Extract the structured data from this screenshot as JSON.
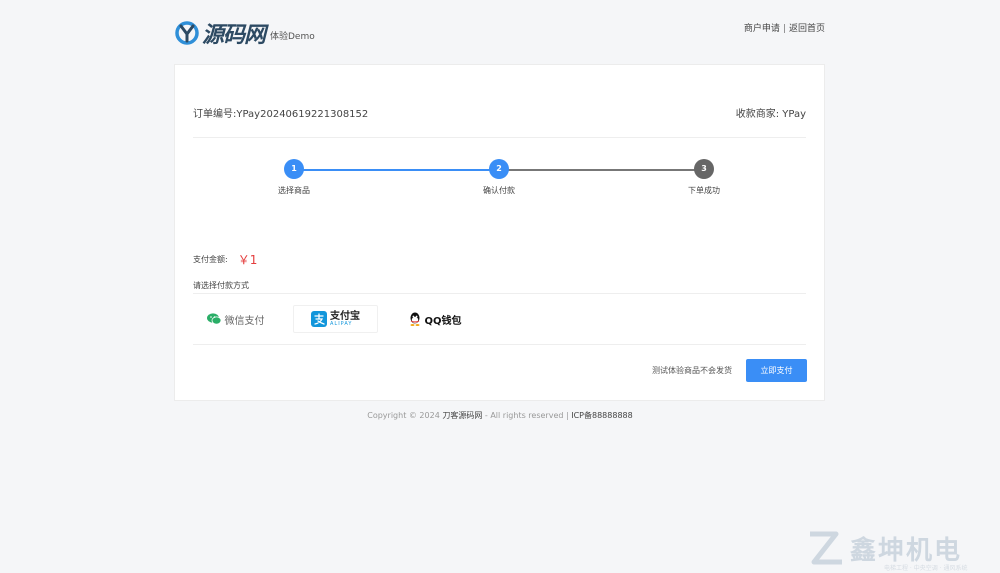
{
  "brand": {
    "logo_text": "源码网",
    "subtitle": "体验Demo",
    "accent_color": "#3a8ef6"
  },
  "top_links": {
    "merchant_apply": "商户申请",
    "separator": "|",
    "back_home": "返回首页"
  },
  "order": {
    "order_no": "订单编号:YPay20240619221308152",
    "merchant": "收款商家: YPay"
  },
  "steps": [
    {
      "num": "1",
      "label": "选择商品",
      "status": "done"
    },
    {
      "num": "2",
      "label": "确认付款",
      "status": "current"
    },
    {
      "num": "3",
      "label": "下单成功",
      "status": "pending"
    }
  ],
  "payment": {
    "amount_label": "支付金额:",
    "amount_value": "￥1",
    "method_label": "请选择付款方式",
    "methods": [
      {
        "id": "wechat",
        "label": "微信支付",
        "icon": "wechat-icon"
      },
      {
        "id": "alipay",
        "label": "支付宝",
        "sub": "ALIPAY",
        "icon": "alipay-icon",
        "selected": true
      },
      {
        "id": "qq",
        "label": "QQ钱包",
        "icon": "qq-icon"
      }
    ],
    "note": "测试体验商品不会发货",
    "pay_button": "立即支付"
  },
  "footer": {
    "copyright": "Copyright © 2024",
    "site_name": "刀客源码网",
    "rights": "- All rights reserved |",
    "icp": "ICP备88888888"
  },
  "watermark": {
    "text": "鑫坤机电",
    "sub": "电梯工程 · 中央空调 · 通风系统"
  }
}
